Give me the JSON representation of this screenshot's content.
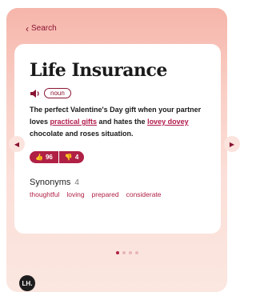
{
  "header": {
    "back_label": "Search"
  },
  "entry": {
    "title": "Life Insurance",
    "part_of_speech": "noun",
    "definition": {
      "part1": "The perfect Valentine's Day gift when your partner loves ",
      "link1": "practical gifts",
      "part2": " and hates the ",
      "link2": "lovey dovey",
      "part3": " chocolate and roses situation."
    },
    "upvotes": "96",
    "downvotes": "4",
    "synonyms_label": "Synonyms",
    "synonyms_count": "4",
    "synonyms": [
      "thoughtful",
      "loving",
      "prepared",
      "considerate"
    ]
  },
  "carousel": {
    "total_pages": 4,
    "active_page": 1
  },
  "logo": {
    "text": "LH."
  },
  "colors": {
    "accent": "#b02045",
    "dark_accent": "#8a1433",
    "background_top": "#f6b5aa",
    "background_bottom": "#fbe6e0"
  },
  "icons": [
    "chevron-left-icon",
    "speaker-icon",
    "thumbs-up-icon",
    "thumbs-down-icon",
    "chevron-left-icon",
    "chevron-right-icon"
  ]
}
